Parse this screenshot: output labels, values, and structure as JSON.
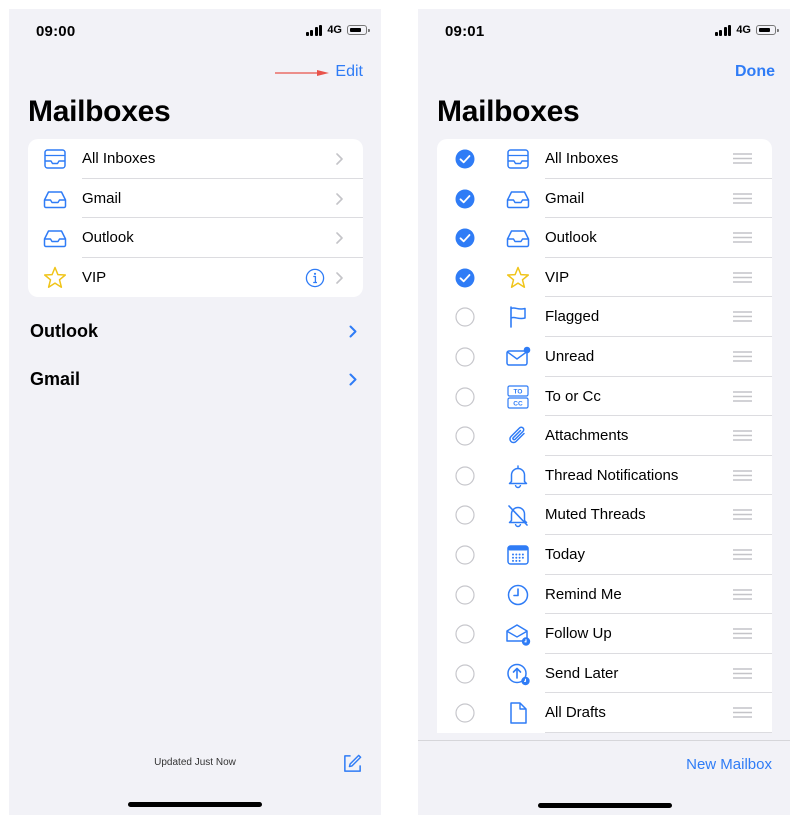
{
  "left": {
    "time": "09:00",
    "network": "4G",
    "edit_label": "Edit",
    "title": "Mailboxes",
    "mailboxes": [
      {
        "label": "All Inboxes",
        "icon": "all-inboxes-icon"
      },
      {
        "label": "Gmail",
        "icon": "inbox-icon"
      },
      {
        "label": "Outlook",
        "icon": "inbox-icon"
      },
      {
        "label": "VIP",
        "icon": "star-icon",
        "info": true
      }
    ],
    "accounts": [
      {
        "label": "Outlook"
      },
      {
        "label": "Gmail"
      }
    ],
    "footer": "Updated Just Now"
  },
  "right": {
    "time": "09:01",
    "network": "4G",
    "done_label": "Done",
    "title": "Mailboxes",
    "mailboxes": [
      {
        "label": "All Inboxes",
        "icon": "all-inboxes-icon",
        "checked": true
      },
      {
        "label": "Gmail",
        "icon": "inbox-icon",
        "checked": true
      },
      {
        "label": "Outlook",
        "icon": "inbox-icon",
        "checked": true
      },
      {
        "label": "VIP",
        "icon": "star-icon",
        "checked": true
      },
      {
        "label": "Flagged",
        "icon": "flag-icon",
        "checked": false
      },
      {
        "label": "Unread",
        "icon": "unread-envelope-icon",
        "checked": false
      },
      {
        "label": "To or Cc",
        "icon": "to-cc-icon",
        "checked": false
      },
      {
        "label": "Attachments",
        "icon": "paperclip-icon",
        "checked": false
      },
      {
        "label": "Thread Notifications",
        "icon": "bell-icon",
        "checked": false
      },
      {
        "label": "Muted Threads",
        "icon": "bell-slash-icon",
        "checked": false
      },
      {
        "label": "Today",
        "icon": "calendar-icon",
        "checked": false
      },
      {
        "label": "Remind Me",
        "icon": "clock-icon",
        "checked": false
      },
      {
        "label": "Follow Up",
        "icon": "follow-up-envelope-icon",
        "checked": false
      },
      {
        "label": "Send Later",
        "icon": "send-later-icon",
        "checked": false
      },
      {
        "label": "All Drafts",
        "icon": "document-icon",
        "checked": false
      }
    ],
    "new_mailbox_label": "New Mailbox"
  },
  "colors": {
    "accent": "#2f7cf6",
    "vip_star": "#f0c419",
    "annotation_arrow": "#e8534a",
    "background": "#f2f2f7"
  }
}
